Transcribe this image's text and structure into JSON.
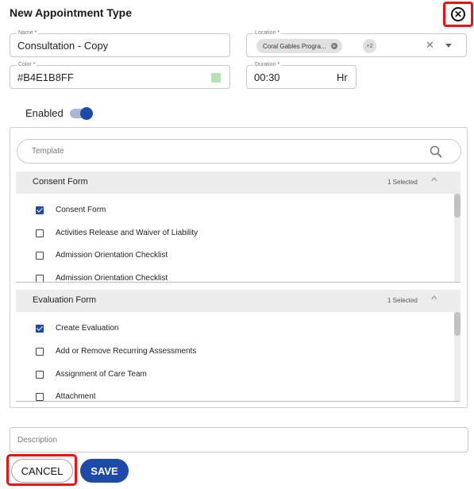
{
  "dialog": {
    "title": "New Appointment Type"
  },
  "name_field": {
    "label": "Name",
    "value": "Consultation - Copy"
  },
  "location_field": {
    "label": "Location",
    "chip_label": "Coral Gables Progra...",
    "more_count": "+2"
  },
  "color_field": {
    "label": "Color",
    "value": "#B4E1B8FF",
    "swatch_color": "#B4E1B8"
  },
  "duration_field": {
    "label": "Duration",
    "value": "00:30",
    "unit": "Hr"
  },
  "required_marker": "*",
  "enabled_toggle": {
    "label": "Enabled",
    "on": true
  },
  "template_search": {
    "placeholder": "Template"
  },
  "sections": [
    {
      "title": "Consent Form",
      "count_label": "1 Selected",
      "items": [
        {
          "label": "Consent Form",
          "checked": true
        },
        {
          "label": "Activities Release and Waiver of Liability",
          "checked": false
        },
        {
          "label": "Admission Orientation Checklist",
          "checked": false
        },
        {
          "label": "Admission Orientation Checklist",
          "checked": false
        }
      ]
    },
    {
      "title": "Evaluation Form",
      "count_label": "1 Selected",
      "items": [
        {
          "label": "Create Evaluation",
          "checked": true
        },
        {
          "label": "Add or Remove Recurring Assessments",
          "checked": false
        },
        {
          "label": "Assignment of Care Team",
          "checked": false
        },
        {
          "label": "Attachment",
          "checked": false
        }
      ]
    }
  ],
  "description_field": {
    "placeholder": "Description"
  },
  "actions": {
    "cancel_label": "CANCEL",
    "save_label": "SAVE"
  },
  "colors": {
    "primary": "#1e4aa8",
    "highlight": "#e11111"
  }
}
